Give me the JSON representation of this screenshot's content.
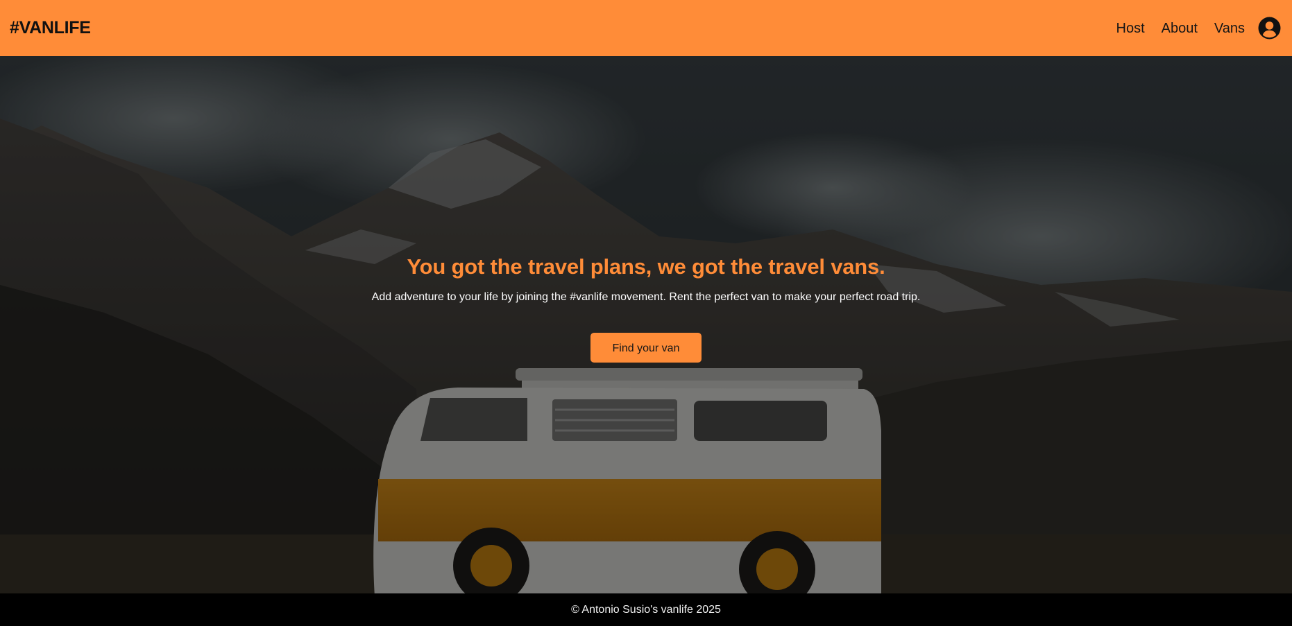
{
  "header": {
    "logo": "#VANLIFE",
    "nav": [
      {
        "label": "Host"
      },
      {
        "label": "About"
      },
      {
        "label": "Vans"
      }
    ],
    "account_icon": "user-circle-icon"
  },
  "hero": {
    "title": "You got the travel plans, we got the travel vans.",
    "subtitle": "Add adventure to your life by joining the #vanlife movement. Rent the perfect van to make your perfect road trip.",
    "cta_label": "Find your van",
    "background": "mountain-landscape-with-orange-van"
  },
  "footer": {
    "text": "© Antonio Susio's vanlife 2025"
  },
  "colors": {
    "accent": "#FF8C38",
    "text_dark": "#161616",
    "footer_bg": "#000000"
  }
}
